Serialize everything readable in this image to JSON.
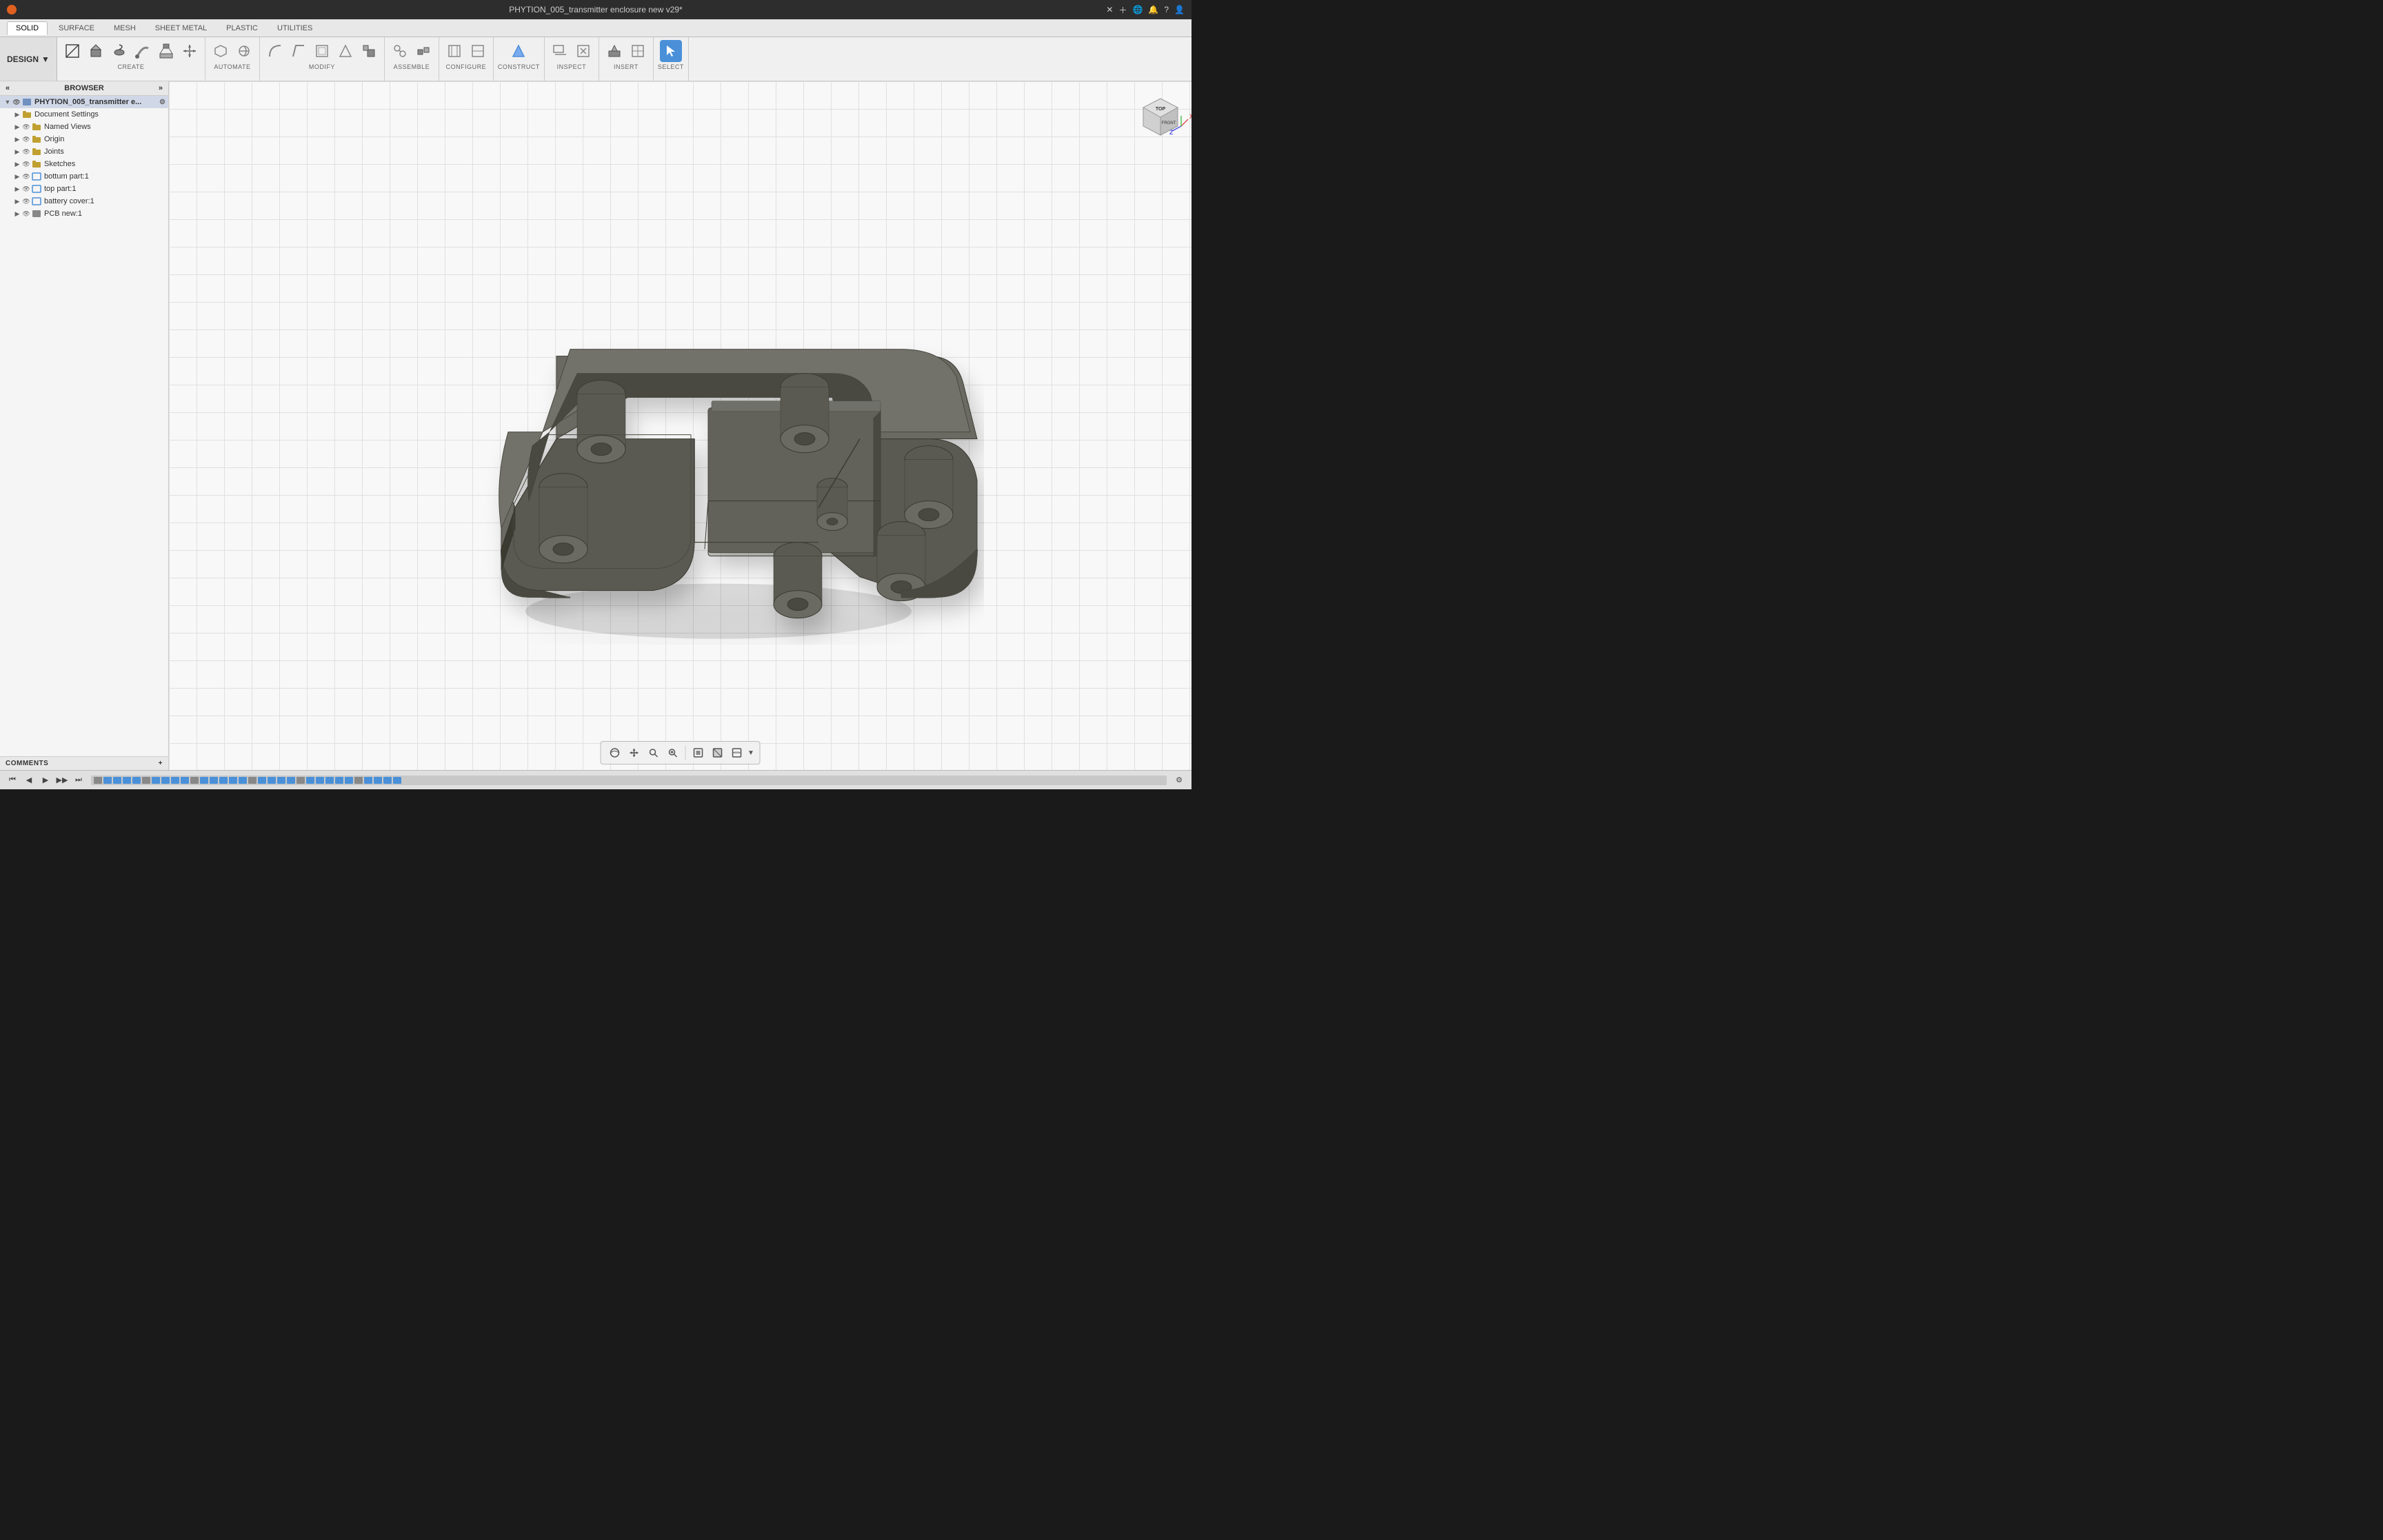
{
  "titlebar": {
    "title": "PHYTION_005_transmitter enclosure new v29*",
    "app_icon": "fusion-icon"
  },
  "tabs": {
    "items": [
      "SOLID",
      "SURFACE",
      "MESH",
      "SHEET METAL",
      "PLASTIC",
      "UTILITIES"
    ],
    "active": "SOLID"
  },
  "design_mode": {
    "label": "DESIGN",
    "chevron": "▼"
  },
  "toolbar_groups": [
    {
      "label": "CREATE",
      "has_dropdown": true,
      "buttons": [
        "new-sketch",
        "extrude",
        "revolve",
        "sweep",
        "loft",
        "move"
      ]
    },
    {
      "label": "AUTOMATE",
      "has_dropdown": true,
      "buttons": [
        "automate1",
        "automate2"
      ]
    },
    {
      "label": "MODIFY",
      "has_dropdown": true,
      "buttons": [
        "fillet",
        "chamfer",
        "shell",
        "draft",
        "scale"
      ]
    },
    {
      "label": "ASSEMBLE",
      "has_dropdown": true,
      "buttons": [
        "assemble1",
        "assemble2"
      ]
    },
    {
      "label": "CONFIGURE",
      "has_dropdown": true,
      "buttons": [
        "configure1",
        "configure2"
      ]
    },
    {
      "label": "CONSTRUCT",
      "has_dropdown": true,
      "buttons": [
        "construct1"
      ]
    },
    {
      "label": "INSPECT",
      "has_dropdown": true,
      "buttons": [
        "inspect1",
        "inspect2"
      ]
    },
    {
      "label": "INSERT",
      "has_dropdown": true,
      "buttons": [
        "insert1",
        "insert2"
      ]
    },
    {
      "label": "SELECT",
      "has_dropdown": true,
      "buttons": [
        "select-btn"
      ],
      "active": true
    }
  ],
  "browser": {
    "header": "BROWSER",
    "collapse_icon": "«",
    "expand_icon": "»",
    "root_item": "PHYTION_005_transmitter e...",
    "items": [
      {
        "label": "Document Settings",
        "indent": 1,
        "type": "settings",
        "expanded": false
      },
      {
        "label": "Named Views",
        "indent": 1,
        "type": "folder",
        "expanded": false
      },
      {
        "label": "Origin",
        "indent": 1,
        "type": "folder",
        "expanded": false
      },
      {
        "label": "Joints",
        "indent": 1,
        "type": "folder",
        "expanded": false
      },
      {
        "label": "Sketches",
        "indent": 1,
        "type": "folder",
        "expanded": false
      },
      {
        "label": "bottum part:1",
        "indent": 1,
        "type": "component",
        "expanded": false
      },
      {
        "label": "top part:1",
        "indent": 1,
        "type": "component",
        "expanded": false
      },
      {
        "label": "battery cover:1",
        "indent": 1,
        "type": "component",
        "expanded": false
      },
      {
        "label": "PCB new:1",
        "indent": 1,
        "type": "component",
        "expanded": false
      }
    ]
  },
  "comments": {
    "label": "COMMENTS",
    "add_icon": "+"
  },
  "viewcube": {
    "top_label": "Top",
    "front_label": "FRONT",
    "axis_x": "X",
    "axis_y": "Y",
    "axis_z": "Z"
  },
  "bottom_toolbar": {
    "buttons": [
      "orbit",
      "pan",
      "zoom-fit",
      "zoom",
      "display-mode",
      "visual-style",
      "environment"
    ]
  },
  "timeline": {
    "play_back_start": "⏮",
    "play_back": "◀",
    "play": "▶",
    "play_forward": "▶▶",
    "play_end": "⏭",
    "steps": 32
  }
}
